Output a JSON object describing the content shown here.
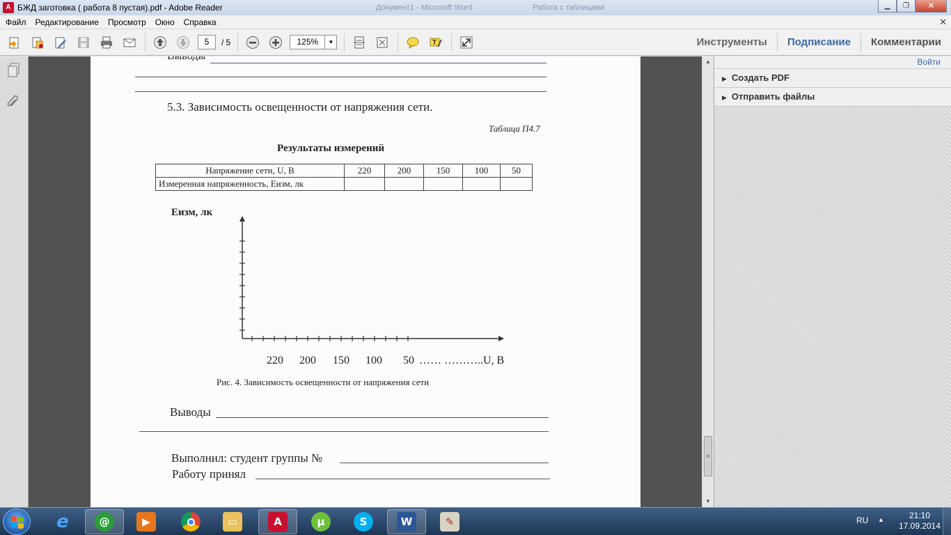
{
  "window": {
    "title": "БЖД заготовка ( работа 8 пустая).pdf - Adobe Reader",
    "ghost_titles": [
      "Документ1 - Microsoft Word",
      "Работа с таблицами"
    ]
  },
  "menu": [
    "Файл",
    "Редактирование",
    "Просмотр",
    "Окно",
    "Справка"
  ],
  "toolbar": {
    "page_current": "5",
    "page_total": "/ 5",
    "zoom": "125%",
    "tabs": [
      "Инструменты",
      "Подписание",
      "Комментарии"
    ]
  },
  "right_panel": {
    "signin": "Войти",
    "sections": [
      "Создать PDF",
      "Отправить файлы"
    ]
  },
  "document": {
    "top_conclusions": "Выводы",
    "section_title": "5.3. Зависимость освещенности от напряжения сети.",
    "table_caption": "Таблица П4.7",
    "table_title": "Результаты измерений",
    "table": {
      "row1_label": "Напряжение сети, U, В",
      "voltages": [
        "220",
        "200",
        "150",
        "100",
        "50"
      ],
      "row2_label": "Измеренная напряженность, Еизм, лк"
    },
    "graph": {
      "y_label": "Еизм, лк",
      "x_ticks": [
        "220",
        "200",
        "150",
        "100",
        "50"
      ],
      "x_unit": "…… ………..U, В",
      "caption": "Рис. 4. Зависимость освещенности от напряжения сети"
    },
    "conclusions": "Выводы",
    "done_by": "Выполнил: студент группы №",
    "accepted_by": "Работу принял"
  },
  "taskbar": {
    "lang": "RU",
    "time": "21:10",
    "date": "17.09.2014"
  }
}
